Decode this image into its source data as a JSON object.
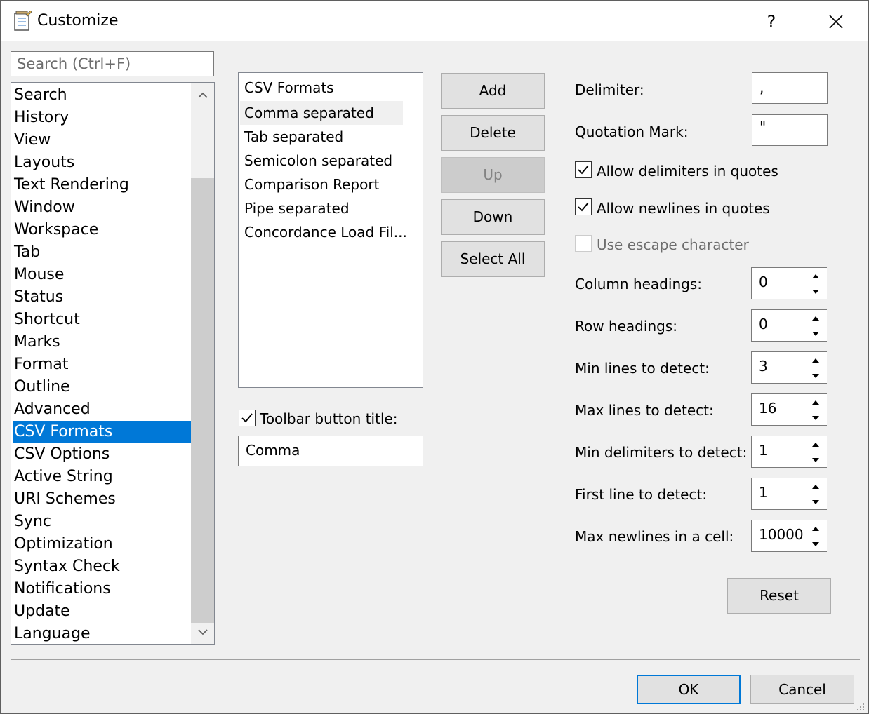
{
  "window": {
    "title": "Customize",
    "help_label": "?"
  },
  "search": {
    "placeholder": "Search (Ctrl+F)",
    "value": ""
  },
  "categories": {
    "items": [
      "Search",
      "History",
      "View",
      "Layouts",
      "Text Rendering",
      "Window",
      "Workspace",
      "Tab",
      "Mouse",
      "Status",
      "Shortcut",
      "Marks",
      "Format",
      "Outline",
      "Advanced",
      "CSV Formats",
      "CSV Options",
      "Active String",
      "URI Schemes",
      "Sync",
      "Optimization",
      "Syntax Check",
      "Notifications",
      "Update",
      "Language"
    ],
    "selected": "CSV Formats"
  },
  "formats": {
    "items": [
      "CSV Formats",
      "Comma separated",
      "Tab separated",
      "Semicolon separated",
      "Comparison Report",
      "Pipe separated",
      "Concordance Load Fil..."
    ],
    "selected": "Comma separated"
  },
  "buttons": {
    "add": "Add",
    "delete": "Delete",
    "up": "Up",
    "down": "Down",
    "select_all": "Select All",
    "reset": "Reset",
    "ok": "OK",
    "cancel": "Cancel"
  },
  "toolbar_title": {
    "label": "Toolbar button title:",
    "checked": true,
    "value": "Comma"
  },
  "settings": {
    "delimiter": {
      "label": "Delimiter:",
      "value": ","
    },
    "quotation": {
      "label": "Quotation Mark:",
      "value": "\""
    },
    "allow_delimiters": {
      "label": "Allow delimiters in quotes",
      "checked": true
    },
    "allow_newlines": {
      "label": "Allow newlines in quotes",
      "checked": true
    },
    "use_escape": {
      "label": "Use escape character",
      "checked": false,
      "disabled": true
    },
    "column_headings": {
      "label": "Column headings:",
      "value": "0"
    },
    "row_headings": {
      "label": "Row headings:",
      "value": "0"
    },
    "min_lines": {
      "label": "Min lines to detect:",
      "value": "3"
    },
    "max_lines": {
      "label": "Max lines to detect:",
      "value": "16"
    },
    "min_delimiters": {
      "label": "Min delimiters to detect:",
      "value": "1"
    },
    "first_line": {
      "label": "First line to detect:",
      "value": "1"
    },
    "max_newlines": {
      "label": "Max newlines in a cell:",
      "value": "10000"
    }
  },
  "colors": {
    "selection": "#0078d7",
    "dialog_bg": "#f0f0f0",
    "button_bg": "#e1e1e1",
    "disabled_button_bg": "#cccccc"
  },
  "icons": {
    "app": "notepad-icon",
    "close": "close-icon",
    "scroll_up": "chevron-up-icon",
    "scroll_down": "chevron-down-icon",
    "check": "checkmark-icon"
  }
}
